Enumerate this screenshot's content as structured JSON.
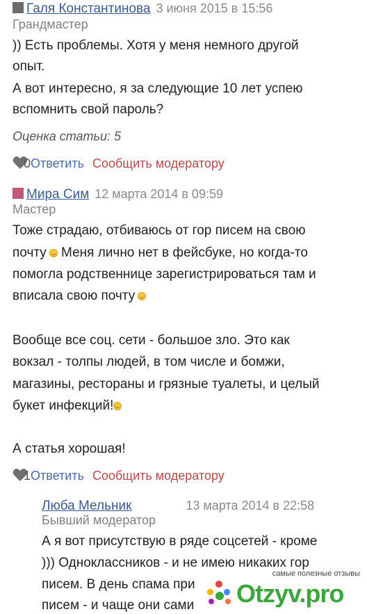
{
  "comments": [
    {
      "author": "Галя Константинова",
      "date": "3 июня 2015 в 15:56",
      "rank": "Грандмастер",
      "lines": [
        ")) Есть проблемы. Хотя у меня немного другой",
        "опыт.",
        "А вот интересно, я за следующие 10 лет успею",
        "вспомнить свой пароль?"
      ],
      "rating": "Оценка статьи: 5",
      "likes": "0",
      "reply": "Ответить",
      "report": "Сообщить модератору"
    },
    {
      "author": "Мира Сим",
      "date": "12 марта 2014 в 09:59",
      "rank": "Мастер",
      "lines": [
        "Тоже страдаю, отбиваюсь от гор писем на свою",
        "почту",
        "Меня лично нет в фейсбуке, но когда-то",
        "помогла родственнице зарегистрироваться там и",
        "вписала свою почту",
        "Вообще все соц. сети - большое зло. Это как",
        "вокзал - толпы людей, в том числе и бомжи,",
        "магазины, рестораны и грязные туалеты, и целый",
        "букет инфекций!",
        "А статья хорошая!"
      ],
      "likes": "1",
      "reply": "Ответить",
      "report": "Сообщить модератору"
    },
    {
      "author": "Люба Мельник",
      "date": "13 марта 2014 в 22:58",
      "rank": "Бывший модератор",
      "lines": [
        "А я вот присутствую в ряде соцсетей - кроме",
        "))) Одноклассников - и не имею никаких гор",
        "писем. В день спама при",
        "писем - и чаще они сами"
      ]
    }
  ],
  "watermark": {
    "tagline": "самые полезные отзывы",
    "logo": "Otzyv.pro"
  },
  "colors": {
    "author": "#3c5a8a",
    "reply": "#4a6aa5",
    "report": "#b24a4a",
    "logo": "#3ca63c"
  }
}
